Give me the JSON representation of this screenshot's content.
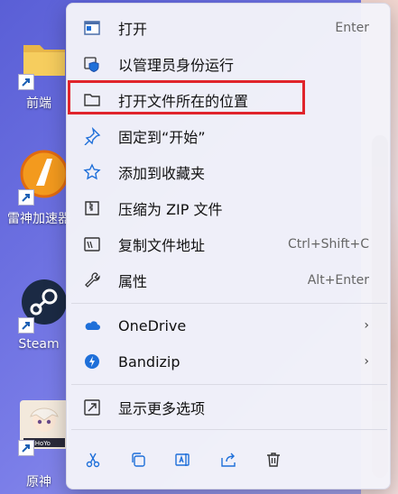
{
  "desktop": {
    "icons": [
      {
        "label": "前端"
      },
      {
        "label": "雷神加速器"
      },
      {
        "label": "Steam"
      },
      {
        "label": "原神"
      }
    ],
    "game_tile_text": "miHoYo"
  },
  "context_menu": {
    "items": [
      {
        "label": "打开",
        "shortcut": "Enter",
        "icon": "app-window-icon"
      },
      {
        "label": "以管理员身份运行",
        "icon": "shield-icon"
      },
      {
        "label": "打开文件所在的位置",
        "icon": "folder-icon"
      },
      {
        "label": "固定到“开始”",
        "icon": "pin-icon"
      },
      {
        "label": "添加到收藏夹",
        "icon": "star-icon"
      },
      {
        "label": "压缩为 ZIP 文件",
        "icon": "zip-icon"
      },
      {
        "label": "复制文件地址",
        "shortcut": "Ctrl+Shift+C",
        "icon": "copy-path-icon"
      },
      {
        "label": "属性",
        "shortcut": "Alt+Enter",
        "icon": "wrench-icon"
      },
      {
        "label": "OneDrive",
        "icon": "onedrive-icon"
      },
      {
        "label": "Bandizip",
        "icon": "bandizip-icon"
      },
      {
        "label": "显示更多选项",
        "icon": "more-options-icon"
      }
    ],
    "bottom_actions": [
      "cut-icon",
      "copy-icon",
      "rename-icon",
      "share-icon",
      "delete-icon"
    ],
    "highlight_color": "#e0242b"
  }
}
